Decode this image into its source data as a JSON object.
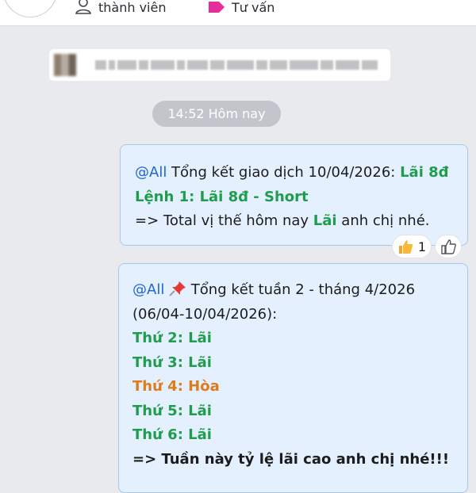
{
  "header": {
    "member_label": "thành viên",
    "consult_label": "Tư vấn",
    "member_icon": "user-icon",
    "consult_icon": "tag-icon",
    "consult_icon_color": "#e62e9b"
  },
  "chat": {
    "time_divider": "14:52 Hôm nay",
    "messages": [
      {
        "mention": "@All",
        "text_1": " Tổng kết giao dịch 10/04/2026: ",
        "highlight_1": "Lãi 8đ",
        "line_2": "Lệnh 1: Lãi 8đ - Short",
        "line_3_prefix": "=> Total vị thế hôm nay ",
        "line_3_highlight": "Lãi",
        "line_3_suffix": " anh chị nhé.",
        "reaction_icon": "thumbs-up-icon",
        "reaction_count": "1"
      },
      {
        "mention": "@All",
        "pin_icon": "pushpin-icon",
        "title": " Tổng kết tuần 2 - tháng 4/2026",
        "date_range": "(06/04-10/04/2026):",
        "days": [
          {
            "label": "Thứ 2: Lãi",
            "status": "win"
          },
          {
            "label": "Thứ 3: Lãi",
            "status": "win"
          },
          {
            "label": "Thứ 4: Hòa",
            "status": "draw"
          },
          {
            "label": "Thứ 5: Lãi",
            "status": "win"
          },
          {
            "label": "Thứ 6: Lãi",
            "status": "win"
          }
        ],
        "closing": "=> Tuần này tỷ lệ lãi cao anh chị nhé!!!"
      }
    ]
  },
  "colors": {
    "mention": "#1e66d0",
    "win": "#1f9d4d",
    "draw": "#e07b1d",
    "bubble_bg": "#e5f0ff",
    "bubble_border": "#a9c6ec"
  }
}
